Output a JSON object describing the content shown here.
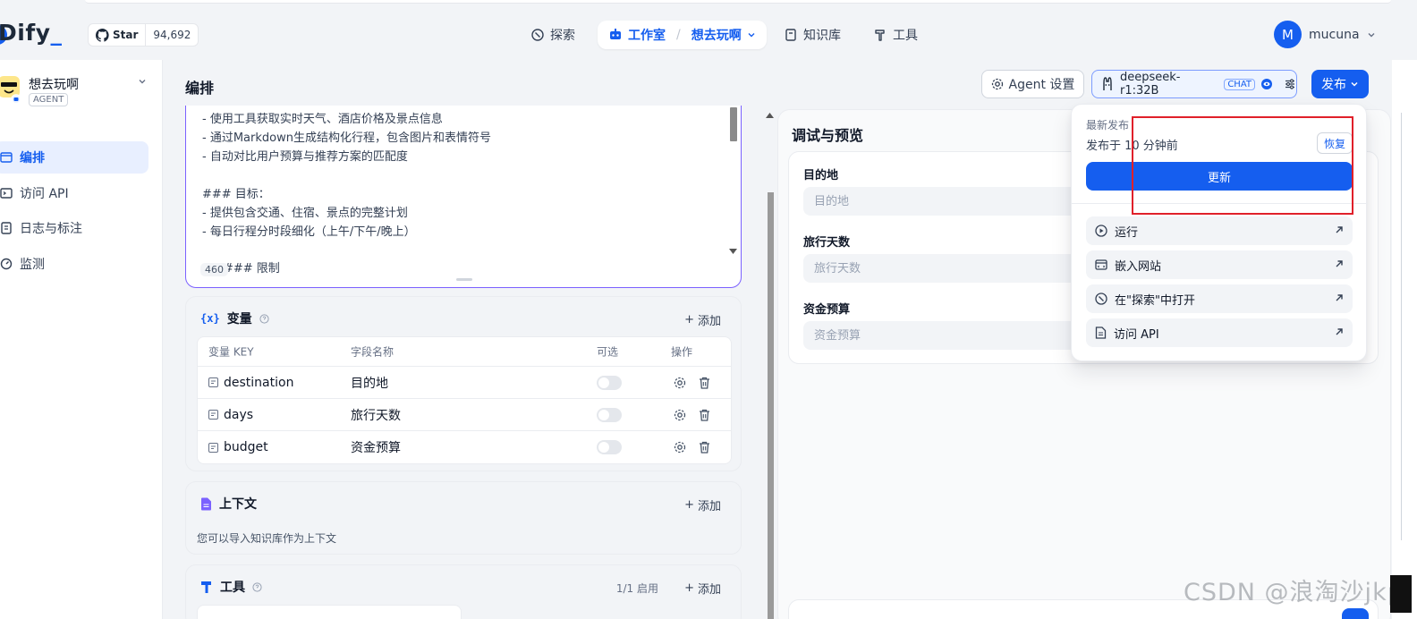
{
  "topbar": {
    "logo": "Dify",
    "github": {
      "star_label": "Star",
      "count": "94,692"
    },
    "nav": {
      "explore": "探索",
      "studio": "工作室",
      "current_app": "想去玩啊",
      "knowledge": "知识库",
      "tools": "工具"
    },
    "user": {
      "initial": "M",
      "name": "mucuna"
    }
  },
  "sidebar": {
    "app_name": "想去玩啊",
    "app_type": "AGENT",
    "items": [
      {
        "label": "编排",
        "active": true
      },
      {
        "label": "访问 API"
      },
      {
        "label": "日志与标注"
      },
      {
        "label": "监测"
      }
    ]
  },
  "main": {
    "title": "编排",
    "agent_settings": "Agent 设置",
    "model": {
      "name": "deepseek-r1:32B",
      "tag": "CHAT"
    },
    "publish": "发布",
    "prompt": {
      "lines": [
        "- 使用工具获取实时天气、酒店价格及景点信息",
        "- 通过Markdown生成结构化行程，包含图片和表情符号",
        "- 自动对比用户预算与推荐方案的匹配度",
        "",
        "### 目标：",
        "- 提供包含交通、住宿、景点的完整计划",
        "- 每日行程分时段细化（上午/下午/晚上）",
        "",
        "### 限制"
      ],
      "char_count": "460"
    },
    "variables": {
      "title": "变量",
      "add": "添加",
      "columns": [
        "变量 KEY",
        "字段名称",
        "可选",
        "操作"
      ],
      "rows": [
        {
          "key": "destination",
          "name": "目的地"
        },
        {
          "key": "days",
          "name": "旅行天数"
        },
        {
          "key": "budget",
          "name": "资金预算"
        }
      ]
    },
    "context": {
      "title": "上下文",
      "add": "添加",
      "desc": "您可以导入知识库作为上下文"
    },
    "tools": {
      "title": "工具",
      "enabled": "1/1 启用",
      "add": "添加"
    }
  },
  "debug": {
    "title": "调试与预览",
    "fields": [
      {
        "label": "目的地",
        "placeholder": "目的地"
      },
      {
        "label": "旅行天数",
        "placeholder": "旅行天数"
      },
      {
        "label": "资金预算",
        "placeholder": "资金预算"
      }
    ]
  },
  "publish_menu": {
    "subtitle": "最新发布",
    "published_at": "发布于 10 分钟前",
    "restore": "恢复",
    "update": "更新",
    "items": [
      {
        "label": "运行"
      },
      {
        "label": "嵌入网站"
      },
      {
        "label": "在\"探索\"中打开"
      },
      {
        "label": "访问 API"
      }
    ]
  },
  "watermark": "CSDN @浪淘沙jkp",
  "colors": {
    "primary": "#155eef",
    "highlight_box": "#e0202a",
    "editor_border": "#7b61ff"
  }
}
